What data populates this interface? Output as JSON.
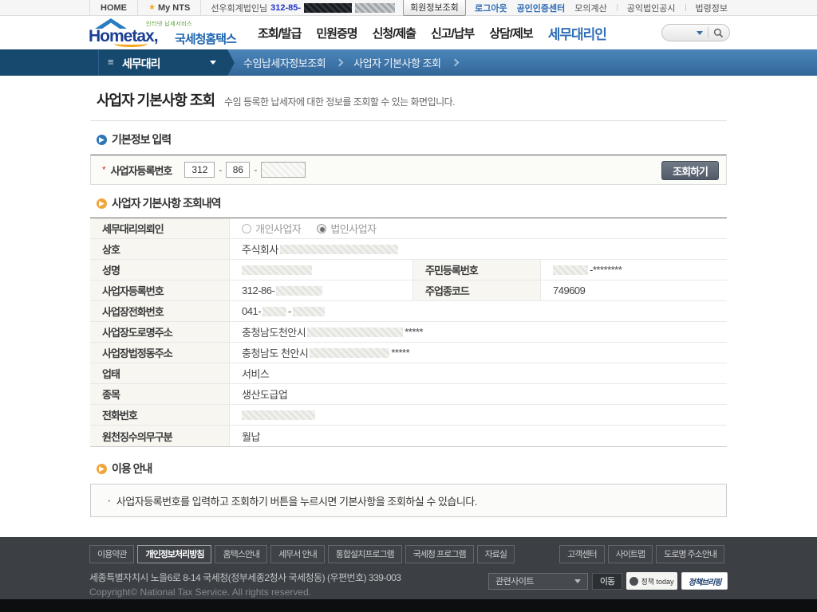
{
  "topbar": {
    "home_label": "HOME",
    "mynts_label": "My NTS",
    "user_name": "선우회계법인님",
    "user_number_prefix": "312-85-",
    "member_info_button": "회원정보조회",
    "link_logout": "로그아웃",
    "link_cert": "공인인증센터",
    "link_calc": "모의계산",
    "link_public": "공익법인공시",
    "link_law": "법령정보"
  },
  "header": {
    "logo_main": "Hometax,",
    "logo_kor": "국세청홈택스",
    "logo_small": "인터넷 납세서비스",
    "nav1": "조회/발급",
    "nav2": "민원증명",
    "nav3": "신청/제출",
    "nav4": "신고/납부",
    "nav5": "상담/제보",
    "nav6": "세무대리인"
  },
  "breadcrumb": {
    "menu_label": "세무대리",
    "item1": "수임납세자정보조회",
    "item2": "사업자 기본사항 조회"
  },
  "page": {
    "title": "사업자 기본사항 조회",
    "description": "수임 등록한 납세자에 대한 정보를 조회할 수 있는 화면입니다."
  },
  "search_section": {
    "heading": "기본정보 입력",
    "required_mark": "*",
    "field_label": "사업자등록번호",
    "input1": "312",
    "input2": "86",
    "input3": "",
    "separator": "-",
    "submit_label": "조회하기"
  },
  "result_section": {
    "heading": "사업자 기본사항 조회내역",
    "client_type_label": "세무대리의뢰인",
    "radio_individual": "개인사업자",
    "radio_corporate": "법인사업자",
    "company_label": "상호",
    "company_prefix": "주식회사",
    "name_label": "성명",
    "resident_label": "주민등록번호",
    "resident_suffix": "-********",
    "bizno_label": "사업자등록번호",
    "bizno_prefix": "312-86-",
    "code_label": "주업종코드",
    "code_value": "749609",
    "bizphone_label": "사업장전화번호",
    "bizphone_prefix": "041-",
    "bizphone_mid": "-",
    "road_label": "사업장도로명주소",
    "road_prefix": "충청남도천안시",
    "road_suffix": "*****",
    "legal_label": "사업장법정동주소",
    "legal_prefix": "충청남도 천안시",
    "legal_suffix": "*****",
    "uptae_label": "업태",
    "uptae_value": "서비스",
    "jongmok_label": "종목",
    "jongmok_value": "생산도급업",
    "phone_label": "전화번호",
    "withhold_label": "원천징수의무구분",
    "withhold_value": "월납"
  },
  "guide_section": {
    "heading": "이용 안내",
    "bullet": "·",
    "note": "사업자등록번호를 입력하고 조회하기 버튼을 누르시면 기본사항을 조회하실 수 있습니다."
  },
  "footer": {
    "btn1": "이용약관",
    "btn2": "개인정보처리방침",
    "btn3": "홈택스안내",
    "btn4": "세무서 안내",
    "btn5": "통합설치프로그램",
    "btn6": "국세청 프로그램",
    "btn7": "자료실",
    "rbtn1": "고객센터",
    "rbtn2": "사이트맵",
    "rbtn3": "도로명 주소안내",
    "address": "세종특별자치시 노을6로 8-14 국세청(정부세종2청사 국세청동) (우편번호) 339-003",
    "copyright": "Copyright© National Tax Service. All rights reserved.",
    "related_select": "관련사이트",
    "go_button": "이동",
    "banner_today": "정책 today",
    "banner_briefing": "정책브리핑"
  },
  "icons": {
    "hamburger": "≡",
    "star": "★",
    "section_arrow": "▶"
  },
  "colors": {
    "accent_blue": "#2e6db5",
    "accent_orange": "#f0a63c",
    "breadcrumb_dark": "#17496f",
    "breadcrumb_light": "#3d77ac",
    "footer_bg": "#3c3f44"
  }
}
